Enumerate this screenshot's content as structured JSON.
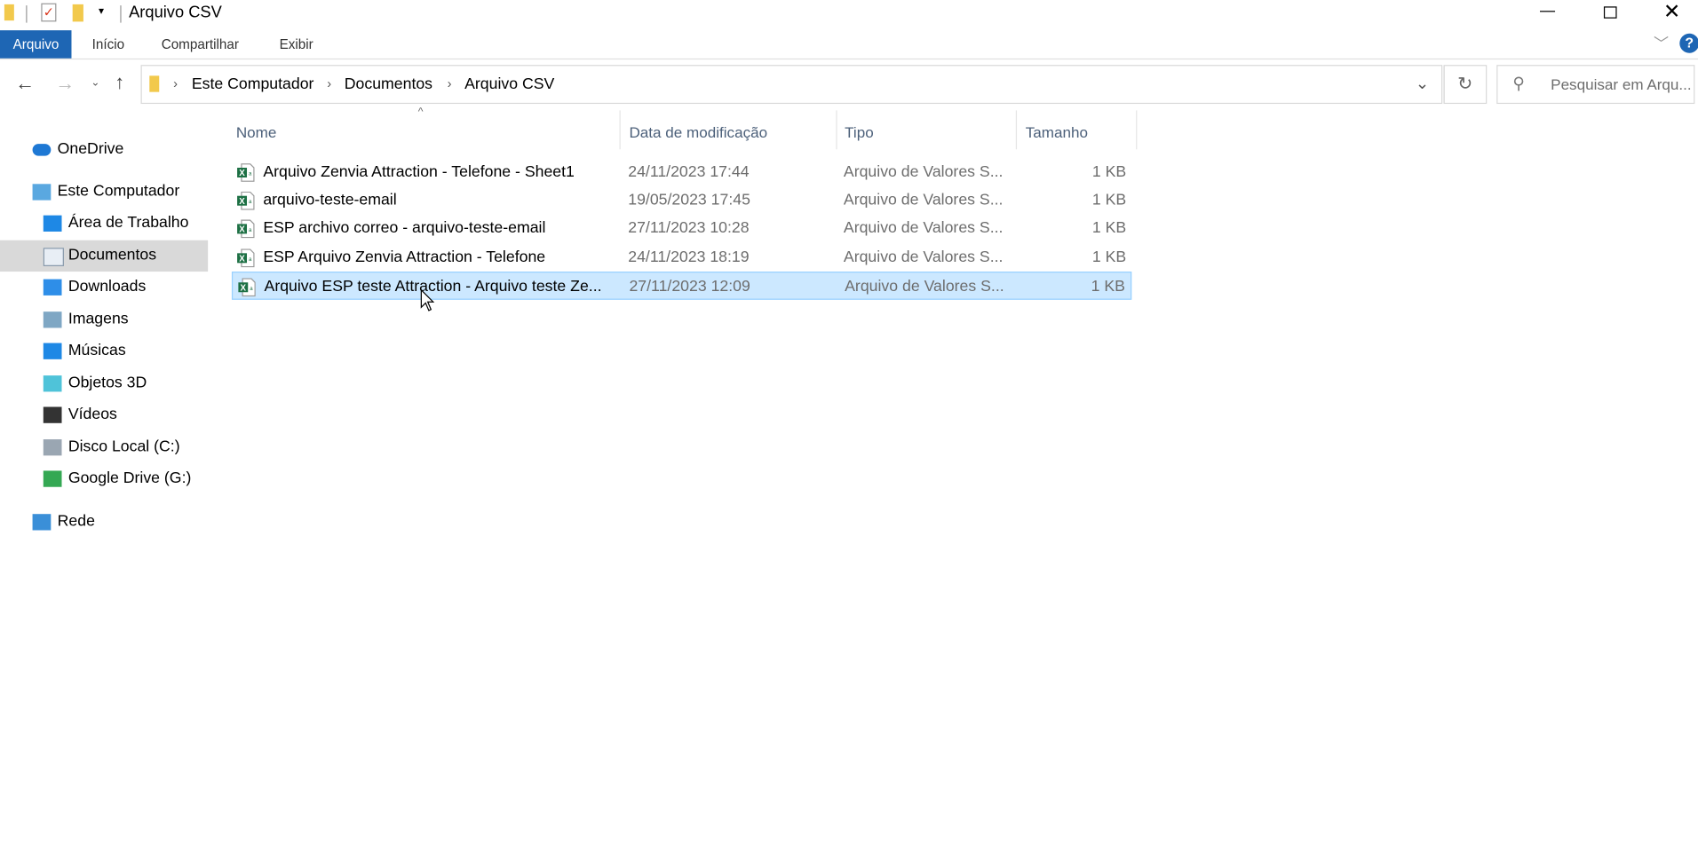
{
  "window": {
    "title": "Arquivo CSV"
  },
  "ribbon": {
    "tabs": [
      {
        "label": "Arquivo",
        "active": true
      },
      {
        "label": "Início"
      },
      {
        "label": "Compartilhar"
      },
      {
        "label": "Exibir"
      }
    ]
  },
  "address": {
    "crumbs": [
      "Este Computador",
      "Documentos",
      "Arquivo CSV"
    ]
  },
  "search": {
    "placeholder": "Pesquisar em Arqu..."
  },
  "sidebar": {
    "items": [
      {
        "label": "OneDrive",
        "icon": "onedrive-icon"
      },
      {
        "label": "Este Computador",
        "icon": "computer-icon"
      },
      {
        "label": "Área de Trabalho",
        "icon": "desktop-icon"
      },
      {
        "label": "Documentos",
        "icon": "documents-icon",
        "selected": true
      },
      {
        "label": "Downloads",
        "icon": "downloads-icon"
      },
      {
        "label": "Imagens",
        "icon": "pictures-icon"
      },
      {
        "label": "Músicas",
        "icon": "music-icon"
      },
      {
        "label": "Objetos 3D",
        "icon": "3d-objects-icon"
      },
      {
        "label": "Vídeos",
        "icon": "videos-icon"
      },
      {
        "label": "Disco Local (C:)",
        "icon": "drive-icon"
      },
      {
        "label": "Google Drive (G:)",
        "icon": "google-drive-icon"
      },
      {
        "label": "Rede",
        "icon": "network-icon"
      }
    ]
  },
  "columns": {
    "name": "Nome",
    "date": "Data de modificação",
    "type": "Tipo",
    "size": "Tamanho"
  },
  "files": [
    {
      "name": "Arquivo Zenvia Attraction - Telefone - Sheet1",
      "date": "24/11/2023 17:44",
      "type": "Arquivo de Valores S...",
      "size": "1 KB"
    },
    {
      "name": "arquivo-teste-email",
      "date": "19/05/2023 17:45",
      "type": "Arquivo de Valores S...",
      "size": "1 KB"
    },
    {
      "name": "ESP archivo correo  - arquivo-teste-email",
      "date": "27/11/2023 10:28",
      "type": "Arquivo de Valores S...",
      "size": "1 KB"
    },
    {
      "name": "ESP Arquivo Zenvia Attraction - Telefone",
      "date": "24/11/2023 18:19",
      "type": "Arquivo de Valores S...",
      "size": "1 KB"
    },
    {
      "name": "Arquivo ESP teste Attraction - Arquivo teste Ze...",
      "date": "27/11/2023 12:09",
      "type": "Arquivo de Valores S...",
      "size": "1 KB",
      "selected": true
    }
  ],
  "colors": {
    "accent": "#1e66b4",
    "selection": "#cce8ff",
    "sidebar_selected": "#d9d9d9"
  }
}
